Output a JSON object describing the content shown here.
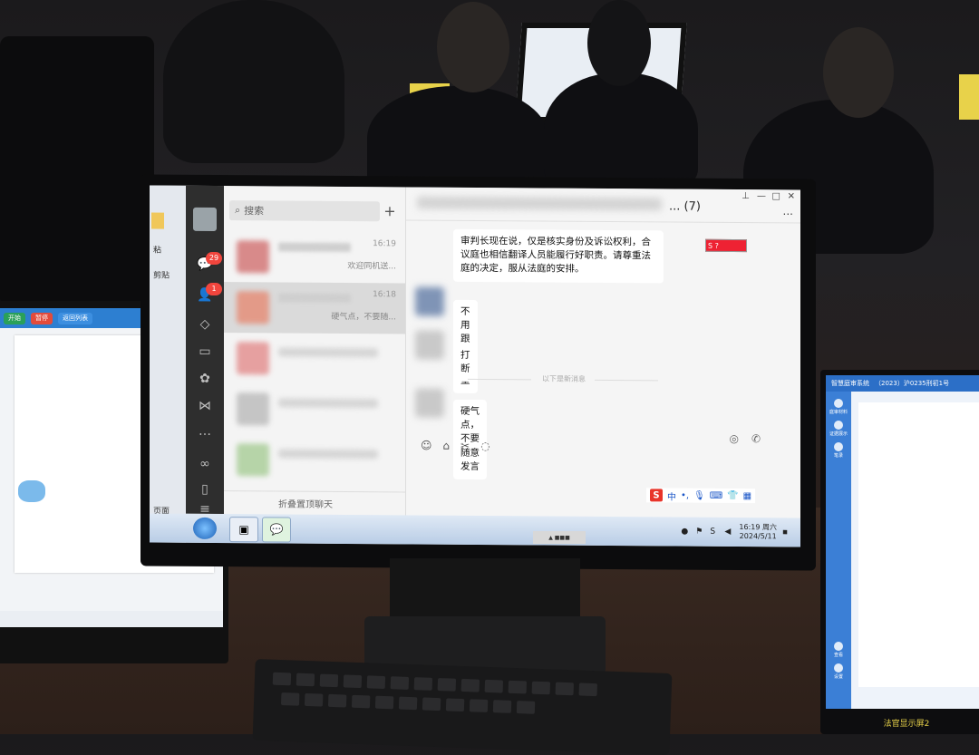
{
  "wechat": {
    "sidebar": {
      "badges": {
        "chats": "29",
        "contacts": "1"
      },
      "icons": [
        "chat-icon",
        "contacts-icon",
        "cube-icon",
        "folder-icon",
        "moments-icon",
        "channels-icon",
        "more-icon",
        "miniprogram-icon",
        "phone-icon",
        "menu-icon"
      ]
    },
    "search": {
      "placeholder": "搜索",
      "add_label": "+"
    },
    "chat_list": [
      {
        "time": "16:19",
        "snippet": "欢迎同机送..."
      },
      {
        "time": "16:18",
        "snippet": "硬气点，不要随..."
      }
    ],
    "fold_label": "折叠置顶聊天",
    "chat": {
      "member_count": "... (7)",
      "messages": [
        {
          "text": "审判长现在说，仅是核实身份及诉讼权利，合议庭也相信翻译人员能履行好职责。请尊重法庭的决定，服从法庭的安排。"
        },
        {
          "text": "不用跟他商量"
        },
        {
          "text": "打断"
        },
        {
          "text": "硬气点，不要随意发言"
        }
      ],
      "divider": "以下是新消息"
    },
    "ime": {
      "logo": "S",
      "lang": "中"
    }
  },
  "taskbar": {
    "time": "16:19 周六",
    "date": "2024/5/11"
  },
  "left_fragment": {
    "items": [
      "粘",
      "剪贴",
      "页面"
    ]
  },
  "left_monitor": {
    "buttons": [
      "开始",
      "暂停",
      "返回列表"
    ]
  },
  "right_monitor": {
    "title": "智慧庭审系统",
    "case_no": "（2023）沪0235刑初1号",
    "label": "法官显示屏2",
    "side_items": [
      "庭审材料",
      "证据展示",
      "笔录",
      "查看",
      "设置"
    ]
  },
  "colors": {
    "wechat_sidebar": "#2e2e2e",
    "badge": "#f1453d",
    "taskbar": "#c8d8ec",
    "court_blue": "#2c6fc7"
  }
}
